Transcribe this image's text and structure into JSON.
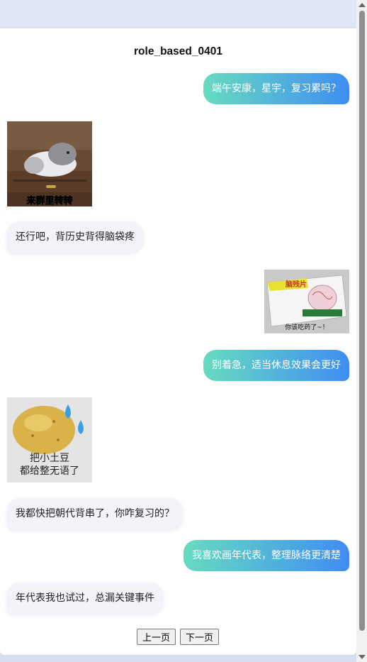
{
  "title": "role_based_0401",
  "messages": [
    {
      "side": "right",
      "kind": "text",
      "text": "端午安康，星宇，复习累吗？"
    },
    {
      "side": "left",
      "kind": "sticker",
      "caption": "来群里转转",
      "icon": "cat-sticker"
    },
    {
      "side": "left",
      "kind": "text",
      "text": "还行吧，背历史背得脑袋疼"
    },
    {
      "side": "right",
      "kind": "sticker",
      "caption": "脑残片",
      "sub": "你该吃药了~！",
      "icon": "medicine-box-sticker"
    },
    {
      "side": "right",
      "kind": "text",
      "text": "别着急，适当休息效果会更好"
    },
    {
      "side": "left",
      "kind": "sticker",
      "caption": "把小土豆\n都给整无语了",
      "caption_line1": "把小土豆",
      "caption_line2": "都给整无语了",
      "icon": "potato-sticker"
    },
    {
      "side": "left",
      "kind": "text",
      "text": "我都快把朝代背串了，你咋复习的？"
    },
    {
      "side": "right",
      "kind": "text",
      "text": "我喜欢画年代表，整理脉络更清楚"
    },
    {
      "side": "left",
      "kind": "text",
      "text": "年代表我也试过，总漏关键事件"
    }
  ],
  "pagination": {
    "prev": "上一页",
    "next": "下一页"
  },
  "colors": {
    "bubble_gradient_start": "#67dbc0",
    "bubble_gradient_end": "#3f8df3",
    "left_bubble": "#f2f4f9"
  }
}
